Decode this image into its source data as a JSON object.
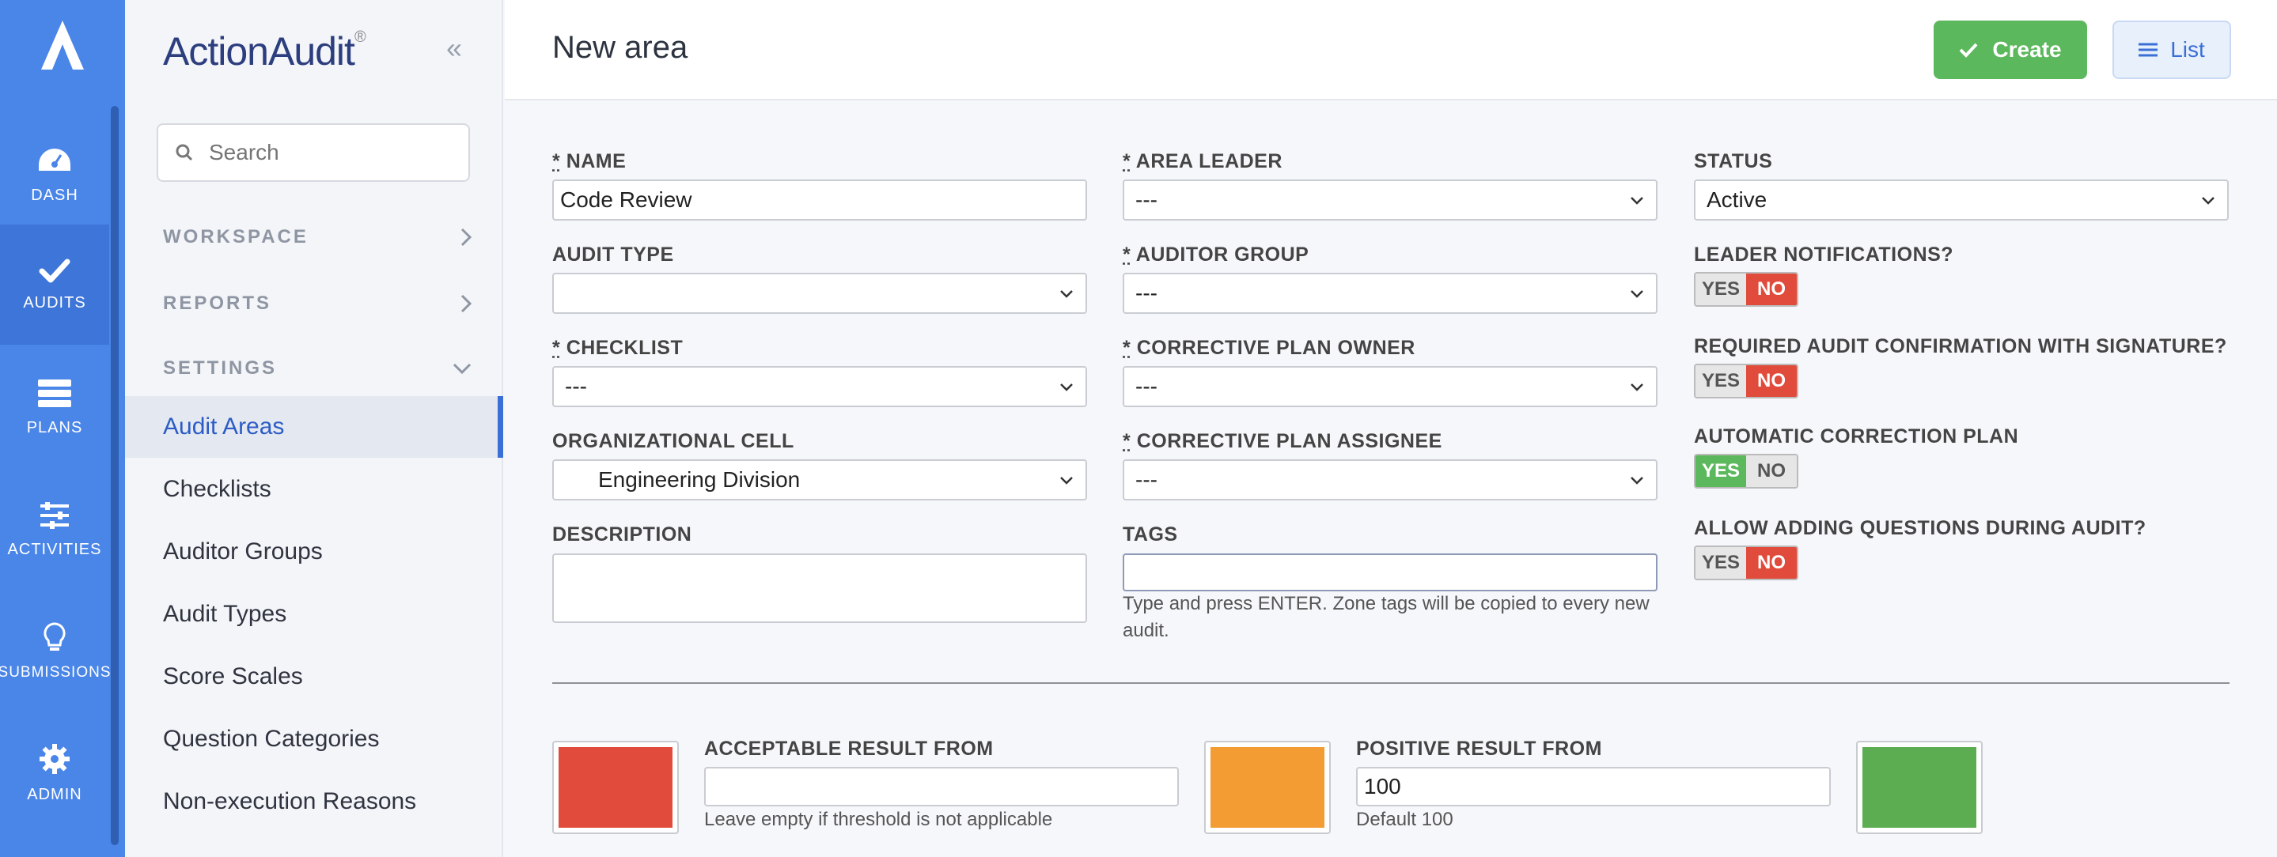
{
  "brand": {
    "name": "ActionAudit",
    "reg": "®"
  },
  "rail": {
    "items": [
      {
        "label": "DASH",
        "icon": "dashboard-icon"
      },
      {
        "label": "AUDITS",
        "icon": "check-icon"
      },
      {
        "label": "PLANS",
        "icon": "plans-icon"
      },
      {
        "label": "ACTIVITIES",
        "icon": "sliders-icon"
      },
      {
        "label": "SUBMISSIONS",
        "icon": "lightbulb-icon"
      },
      {
        "label": "ADMIN",
        "icon": "gear-icon"
      }
    ]
  },
  "nav": {
    "search_placeholder": "Search",
    "sections": [
      "WORKSPACE",
      "REPORTS",
      "SETTINGS"
    ],
    "links": [
      "Audit Areas",
      "Checklists",
      "Auditor Groups",
      "Audit Types",
      "Score Scales",
      "Question Categories",
      "Non-execution Reasons"
    ]
  },
  "header": {
    "title": "New area",
    "create_label": "Create",
    "list_label": "List"
  },
  "form": {
    "name_label": "NAME",
    "name_value": "Code Review",
    "audit_type_label": "AUDIT TYPE",
    "audit_type_value": "",
    "checklist_label": "CHECKLIST",
    "checklist_value": "---",
    "org_cell_label": "ORGANIZATIONAL CELL",
    "org_cell_value": "Engineering Division",
    "description_label": "DESCRIPTION",
    "area_leader_label": "AREA LEADER",
    "area_leader_value": "---",
    "auditor_group_label": "AUDITOR GROUP",
    "auditor_group_value": "---",
    "cp_owner_label": "CORRECTIVE PLAN OWNER",
    "cp_owner_value": "---",
    "cp_assignee_label": "CORRECTIVE PLAN ASSIGNEE",
    "cp_assignee_value": "---",
    "tags_label": "TAGS",
    "tags_help": "Type and press ENTER. Zone tags will be copied to every new audit.",
    "status_label": "STATUS",
    "status_value": "Active",
    "leader_notif_label": "LEADER NOTIFICATIONS?",
    "req_confirm_label": "REQUIRED AUDIT CONFIRMATION WITH SIGNATURE?",
    "auto_correction_label": "AUTOMATIC CORRECTION PLAN",
    "allow_questions_label": "ALLOW ADDING QUESTIONS DURING AUDIT?",
    "yes": "YES",
    "no": "NO",
    "req_mark": "*",
    "toggles": {
      "leader_notifications": false,
      "required_confirmation": false,
      "automatic_correction": true,
      "allow_questions": false
    }
  },
  "thresholds": {
    "acceptable_label": "ACCEPTABLE RESULT FROM",
    "acceptable_value": "",
    "acceptable_help": "Leave empty if threshold is not applicable",
    "positive_label": "POSITIVE RESULT FROM",
    "positive_value": "100",
    "positive_help": "Default 100",
    "colors": {
      "bad": "#e04b3b",
      "acceptable": "#f39c34",
      "positive": "#5cad52"
    }
  }
}
